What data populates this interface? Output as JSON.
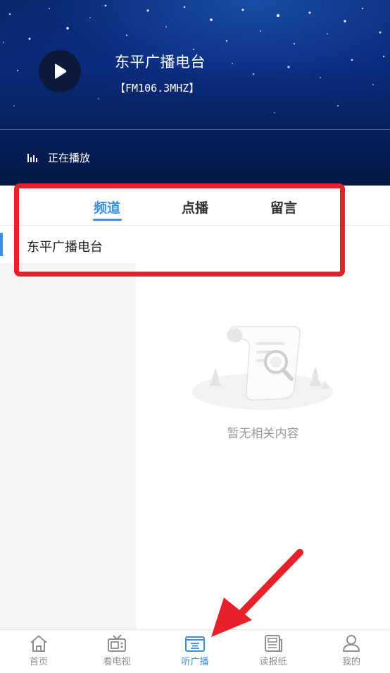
{
  "player": {
    "station_name": "东平广播电台",
    "frequency": "【FM106.3MHZ】",
    "status": "正在播放",
    "play_icon": "play-icon",
    "status_icon": "equalizer-bars-icon"
  },
  "tabs": [
    {
      "label": "频道",
      "active": true
    },
    {
      "label": "点播",
      "active": false
    },
    {
      "label": "留言",
      "active": false
    }
  ],
  "channels": [
    {
      "label": "东平广播电台",
      "selected": true
    }
  ],
  "empty_state": {
    "message": "暂无相关内容",
    "icon": "empty-document-search-icon"
  },
  "bottom_nav": [
    {
      "label": "首页",
      "icon": "home-icon",
      "active": false
    },
    {
      "label": "看电视",
      "icon": "tv-icon",
      "active": false
    },
    {
      "label": "听广播",
      "icon": "radio-icon",
      "active": true
    },
    {
      "label": "读报纸",
      "icon": "newspaper-icon",
      "active": false
    },
    {
      "label": "我的",
      "icon": "user-icon",
      "active": false
    }
  ],
  "colors": {
    "accent": "#3d8fe3",
    "header_bg": "#0a2a78",
    "annotation": "#e8202a"
  }
}
